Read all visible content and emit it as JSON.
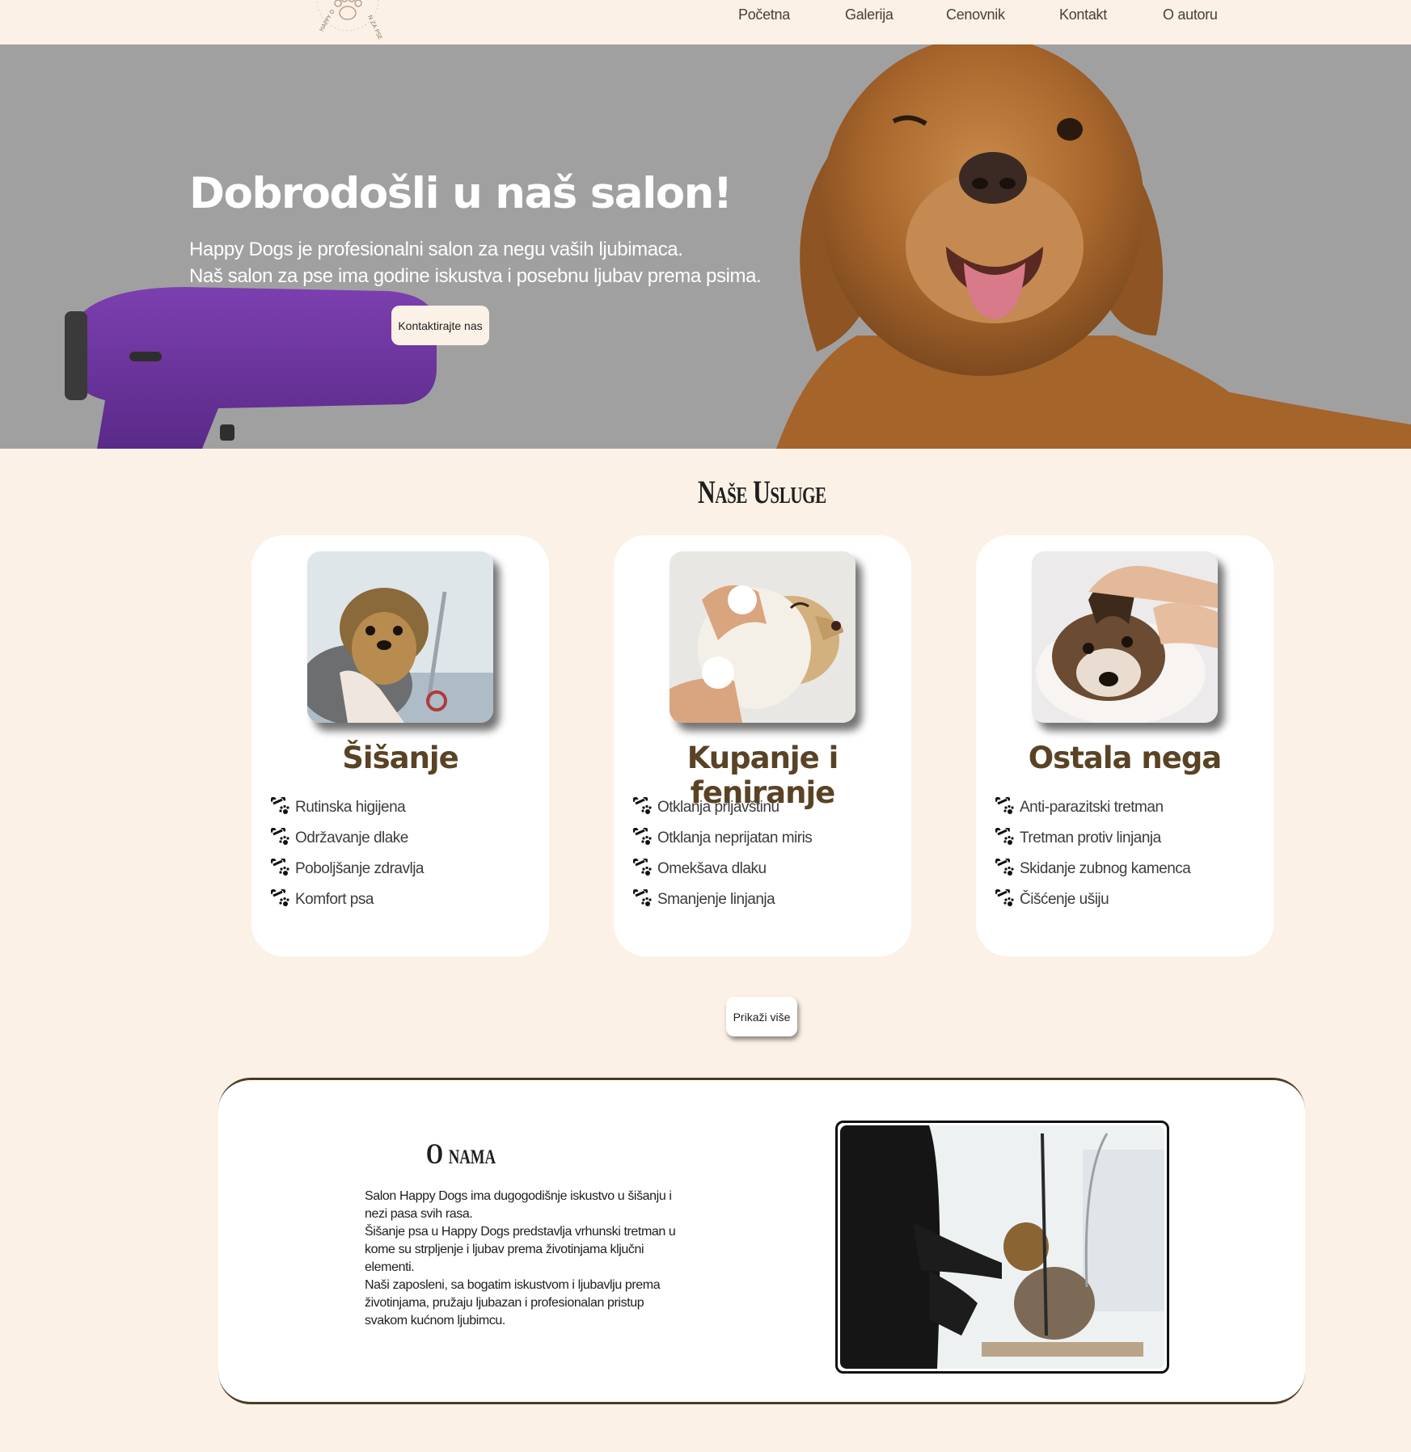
{
  "nav": {
    "logo_top_text": "HAPPY D",
    "logo_right_text": "N ZA PSE",
    "links": [
      "Početna",
      "Galerija",
      "Cenovnik",
      "Kontakt",
      "O autoru"
    ]
  },
  "hero": {
    "title": "Dobrodošli u naš salon!",
    "line1": "Happy Dogs je profesionalni salon za negu vaših ljubimaca.",
    "line2": "Naš salon za pse ima godine iskustva i posebnu ljubav prema psima.",
    "cta_label": "Kontaktirajte nas"
  },
  "services": {
    "title": "Naše Usluge",
    "cards": [
      {
        "title": "Šišanje",
        "icon": "bone-paw-icon",
        "items": [
          "Rutinska higijena",
          "Održavanje dlake",
          "Poboljšanje zdravlja",
          "Komfort psa"
        ]
      },
      {
        "title": "Kupanje i feniranje",
        "icon": "bone-paw-icon",
        "items": [
          "Otklanja prljavštinu",
          "Otklanja neprijatan miris",
          "Omekšava dlaku",
          "Smanjenje linjanja"
        ]
      },
      {
        "title": "Ostala nega",
        "icon": "bone-paw-icon",
        "items": [
          "Anti-parazitski tretman",
          "Tretman protiv linjanja",
          "Skidanje zubnog kamenca",
          "Čišćenje ušiju"
        ]
      }
    ],
    "more_label": "Prikaži više"
  },
  "about": {
    "title": "O nama",
    "paragraphs": [
      "Salon Happy Dogs ima dugogodišnje iskustvo u šišanju i nezi pasa svih rasa.",
      "Šišanje psa u Happy Dogs predstavlja vrhunski tretman u kome su strpljenje i ljubav prema životinjama ključni elementi.",
      "Naši zaposleni, sa bogatim iskustvom i ljubavlju prema životinjama, pružaju ljubazan i profesionalan pristup svakom kućnom ljubimcu."
    ]
  },
  "colors": {
    "page_bg": "#fcf1e6",
    "card_bg": "#ffffff",
    "card_title": "#5a4325",
    "hero_overlay": "#a1a0a1",
    "accent_border": "#4b3b26"
  }
}
